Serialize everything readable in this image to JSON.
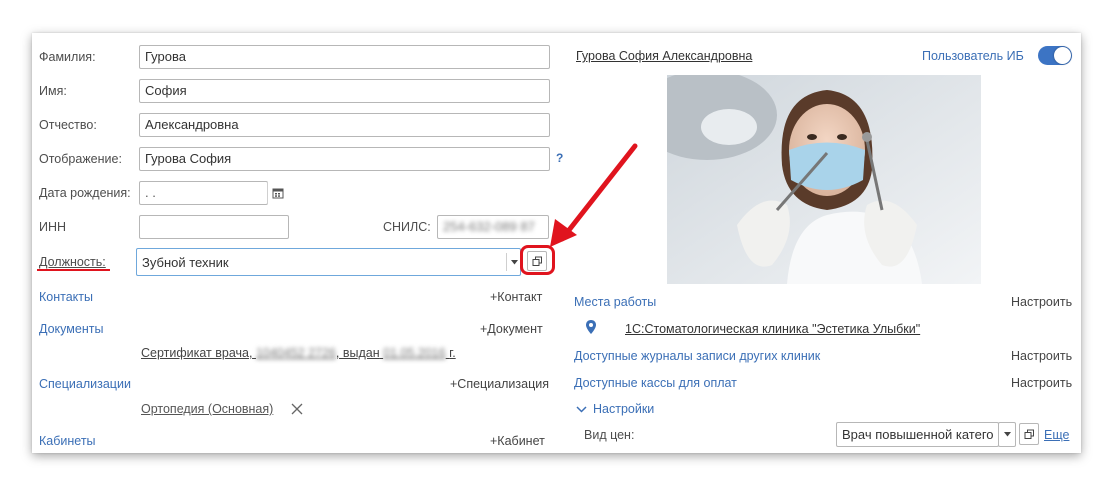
{
  "form": {
    "surname_label": "Фамилия:",
    "surname_value": "Гурова",
    "name_label": "Имя:",
    "name_value": "София",
    "patronymic_label": "Отчество:",
    "patronymic_value": "Александровна",
    "display_label": "Отображение:",
    "display_value": "Гурова София",
    "help_mark": "?",
    "birth_label": "Дата рождения:",
    "birth_value": " .  .",
    "inn_label": "ИНН",
    "inn_value": "",
    "snils_label": "СНИЛС:",
    "snils_value": "254-632-089 87",
    "position_label": "Должность:",
    "position_value": "Зубной техник"
  },
  "sections": {
    "contacts_label": "Контакты",
    "contacts_add": "+Контакт",
    "documents_label": "Документы",
    "documents_add": "+Документ",
    "document_item_prefix": "Сертификат врача,",
    "document_item_number": "1040452 2726",
    "document_item_mid": ", выдан",
    "document_item_date": "01.05.2016",
    "document_item_suffix": "г.",
    "specializations_label": "Специализации",
    "specializations_add": "+Специализация",
    "specialization_item": "Ортопедия (Основная)",
    "cabinets_label": "Кабинеты",
    "cabinets_add": "+Кабинет"
  },
  "right": {
    "employee_name": "Гурова София Александровна",
    "ib_user_label": "Пользователь ИБ",
    "ib_user_enabled": true,
    "workplaces_label": "Места работы",
    "workplaces_configure": "Настроить",
    "clinic_name": "1С:Стоматологическая клиника \"Эстетика Улыбки\"",
    "journals_label": "Доступные журналы записи других клиник",
    "journals_configure": "Настроить",
    "cashboxes_label": "Доступные кассы для оплат",
    "cashboxes_configure": "Настроить",
    "settings_label": "Настройки",
    "price_type_label": "Вид цен:",
    "price_type_value": "Врач повышенной катего",
    "more_label": "Еще"
  },
  "colors": {
    "link": "#3b6fb6",
    "toggle": "#3c74c4",
    "annotation_red": "#e0141e"
  },
  "icons": {
    "calendar": "calendar-icon",
    "open": "open-window-icon",
    "dropdown": "chevron-down-icon",
    "pin": "map-pin-icon",
    "remove": "close-icon",
    "settings_toggle": "chevron-down-icon"
  }
}
